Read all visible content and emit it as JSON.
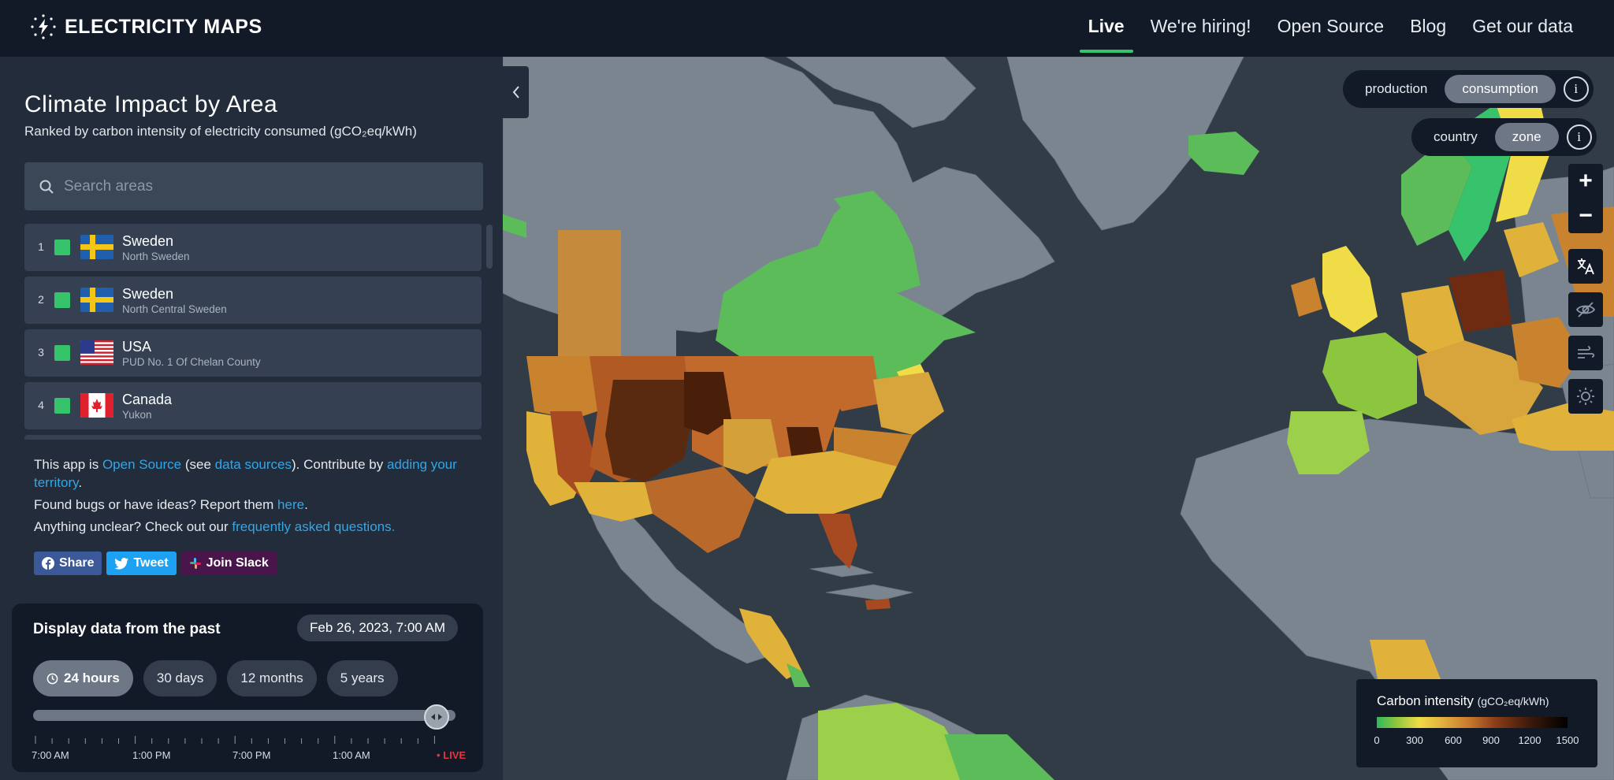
{
  "brand": {
    "name": "ELECTRICITY MAPS"
  },
  "nav": {
    "items": [
      "Live",
      "We're hiring!",
      "Open Source",
      "Blog",
      "Get our data"
    ]
  },
  "sidebar": {
    "title": "Climate Impact by Area",
    "subtitle": "Ranked by carbon intensity of electricity consumed (gCO₂eq/kWh)",
    "search_placeholder": "Search areas",
    "rankings": [
      {
        "rank": "1",
        "country": "Sweden",
        "zone": "North Sweden",
        "color": "#37c26c",
        "flag": "sweden"
      },
      {
        "rank": "2",
        "country": "Sweden",
        "zone": "North Central Sweden",
        "color": "#37c26c",
        "flag": "sweden"
      },
      {
        "rank": "3",
        "country": "USA",
        "zone": "PUD No. 1 Of Chelan County",
        "color": "#37c26c",
        "flag": "usa"
      },
      {
        "rank": "4",
        "country": "Canada",
        "zone": "Yukon",
        "color": "#37c26c",
        "flag": "canada"
      }
    ],
    "info": {
      "l1a": "This app is ",
      "l1b": "Open Source",
      "l1c": " (see ",
      "l1d": "data sources",
      "l1e": "). Contribute by ",
      "l1f": "adding your territory",
      "l1g": ".",
      "l2a": "Found bugs or have ideas? Report them ",
      "l2b": "here",
      "l2c": ".",
      "l3a": "Anything unclear? Check out our ",
      "l3b": "frequently asked questions."
    },
    "social": {
      "share": "Share",
      "tweet": "Tweet",
      "slack": "Join Slack"
    }
  },
  "time_panel": {
    "title": "Display data from the past",
    "date": "Feb 26, 2023, 7:00 AM",
    "tabs": [
      "24 hours",
      "30 days",
      "12 months",
      "5 years"
    ],
    "selected_tab": "24 hours",
    "axis_labels": [
      "7:00 AM",
      "1:00 PM",
      "7:00 PM",
      "1:00 AM"
    ],
    "live_label": "LIVE",
    "slider_position": 1.0
  },
  "map_controls": {
    "mode_toggle": {
      "options": [
        "production",
        "consumption"
      ],
      "selected": "consumption"
    },
    "area_toggle": {
      "options": [
        "country",
        "zone"
      ],
      "selected": "zone"
    },
    "info_label": "i",
    "icons": [
      "zoom-in-icon",
      "zoom-out-icon",
      "language-icon",
      "hide-icon",
      "wind-icon",
      "sun-icon"
    ]
  },
  "legend": {
    "title": "Carbon intensity",
    "unit": "(gCO₂eq/kWh)",
    "ticks": [
      "0",
      "300",
      "600",
      "900",
      "1200",
      "1500"
    ]
  },
  "colors": {
    "low": "#37c26c",
    "mid": "#f0dc46",
    "high": "#8a3d19",
    "very_high": "#3e1a0a",
    "no_data": "#7a858f",
    "water": "#323c47",
    "accent": "#37c26c",
    "link": "#33a6e8",
    "live": "#e5333f"
  }
}
